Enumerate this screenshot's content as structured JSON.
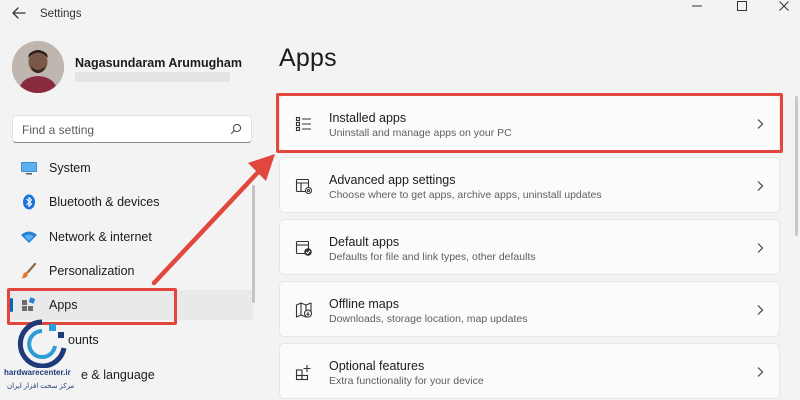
{
  "window": {
    "title": "Settings"
  },
  "user": {
    "name": "Nagasundaram Arumugham"
  },
  "search": {
    "placeholder": "Find a setting"
  },
  "sidebar": {
    "items": [
      {
        "label": "System",
        "icon": "monitor-icon",
        "active": false
      },
      {
        "label": "Bluetooth & devices",
        "icon": "bluetooth-icon",
        "active": false
      },
      {
        "label": "Network & internet",
        "icon": "wifi-icon",
        "active": false
      },
      {
        "label": "Personalization",
        "icon": "paintbrush-icon",
        "active": false
      },
      {
        "label": "Apps",
        "icon": "apps-icon",
        "active": true
      },
      {
        "label": "ounts",
        "icon": "accounts-icon",
        "active": false
      },
      {
        "label": "e & language",
        "icon": "time-language-icon",
        "active": false
      }
    ]
  },
  "main": {
    "title": "Apps",
    "cards": [
      {
        "title": "Installed apps",
        "subtitle": "Uninstall and manage apps on your PC",
        "icon": "installed-apps-icon"
      },
      {
        "title": "Advanced app settings",
        "subtitle": "Choose where to get apps, archive apps, uninstall updates",
        "icon": "advanced-app-settings-icon"
      },
      {
        "title": "Default apps",
        "subtitle": "Defaults for file and link types, other defaults",
        "icon": "default-apps-icon"
      },
      {
        "title": "Offline maps",
        "subtitle": "Downloads, storage location, map updates",
        "icon": "offline-maps-icon"
      },
      {
        "title": "Optional features",
        "subtitle": "Extra functionality for your device",
        "icon": "optional-features-icon"
      }
    ]
  },
  "watermark": {
    "site": "hardwarecenter.ir",
    "tagline": "مرکز سخت افزار ایران"
  },
  "colors": {
    "accent": "#0067c0",
    "highlight": "#e2473e",
    "background": "#f3f3f3",
    "card": "#fbfbfb"
  }
}
